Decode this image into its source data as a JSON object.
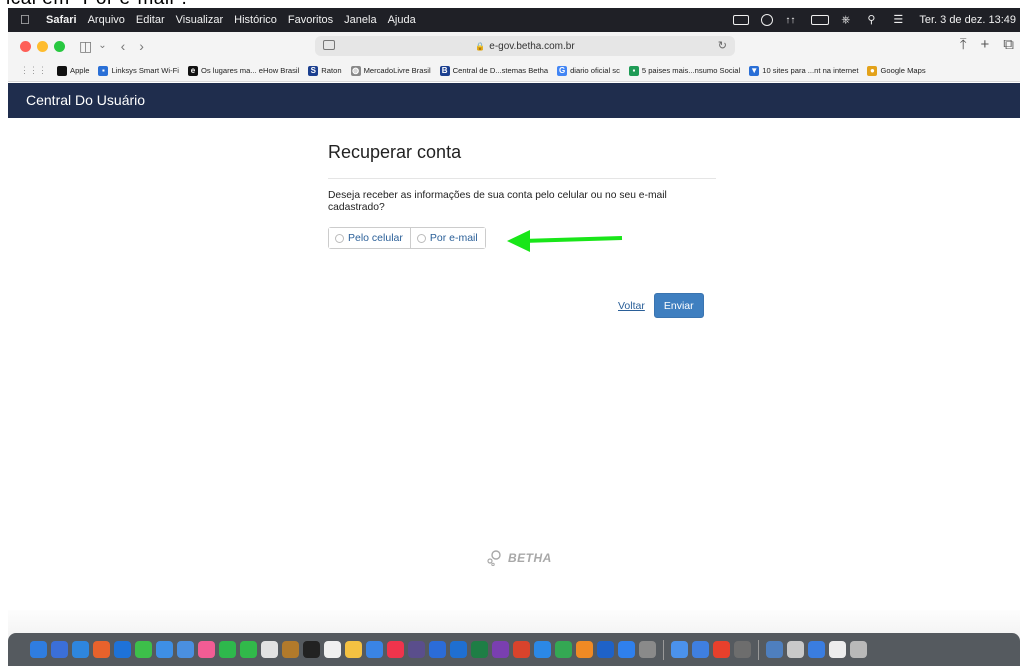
{
  "instruction": "ical em \"Por e-mail\".",
  "menubar": {
    "app": "Safari",
    "items": [
      "Arquivo",
      "Editar",
      "Visualizar",
      "Histórico",
      "Favoritos",
      "Janela",
      "Ajuda"
    ],
    "clock": "Ter. 3 de dez. 13:49"
  },
  "toolbar": {
    "url": "e-gov.betha.com.br"
  },
  "bookmarks": [
    {
      "label": "Apple",
      "color": "#111111",
      "glyph": ""
    },
    {
      "label": "Linksys Smart Wi-Fi",
      "color": "#2a6fd6",
      "glyph": "▪"
    },
    {
      "label": "Os lugares ma... eHow Brasil",
      "color": "#111111",
      "glyph": "e"
    },
    {
      "label": "Raton",
      "color": "#1b3f8f",
      "glyph": "S"
    },
    {
      "label": "MercadoLivre Brasil",
      "color": "#888888",
      "glyph": "◍"
    },
    {
      "label": "Central de D...stemas Betha",
      "color": "#1b3f8f",
      "glyph": "B"
    },
    {
      "label": "diario oficial sc",
      "color": "#4285f4",
      "glyph": "G"
    },
    {
      "label": "5 paises mais...nsumo Social",
      "color": "#1e9b55",
      "glyph": "▪"
    },
    {
      "label": "10 sites para ...nt na internet",
      "color": "#2a6fd6",
      "glyph": "▼"
    },
    {
      "label": "Google Maps",
      "color": "#e3a21a",
      "glyph": "●"
    }
  ],
  "navbar": {
    "brand": "Central Do Usuário"
  },
  "page": {
    "title": "Recuperar conta",
    "question": "Deseja receber as informações de sua conta pelo celular ou no seu e-mail cadastrado?",
    "option_phone": "Pelo celular",
    "option_email": "Por e-mail",
    "back_link": "Voltar",
    "send_button": "Enviar"
  },
  "annotation": {
    "arrow_color": "#19e619"
  },
  "footer": {
    "logo": "BETHA"
  },
  "dock": {
    "icons": [
      "#2f7de1",
      "#3b6fd8",
      "#2e86de",
      "#e8622c",
      "#1e72d8",
      "#3dbf4a",
      "#3e8fe6",
      "#4a8fe0",
      "#f25c94",
      "#2eb84c",
      "#31b94a",
      "#e2e2e2",
      "#b27a2b",
      "#222222",
      "#f0f0f0",
      "#f5c242",
      "#3a84e5",
      "#f0344c",
      "#5a4e8c",
      "#2b6cd8",
      "#1f6fd1",
      "#1e7e45",
      "#7a3fb0",
      "#d9432c",
      "#2b88e6",
      "#34a853",
      "#f08a24",
      "#1e62c8",
      "#2f80ed",
      "#8a8a8a",
      "#4b92ec",
      "#3f7fe0",
      "#e8402c",
      "#6d6d6d",
      "#4e7fbf",
      "#c9c9c9",
      "#3a7de0",
      "#ededed",
      "#b9b9b9"
    ]
  }
}
